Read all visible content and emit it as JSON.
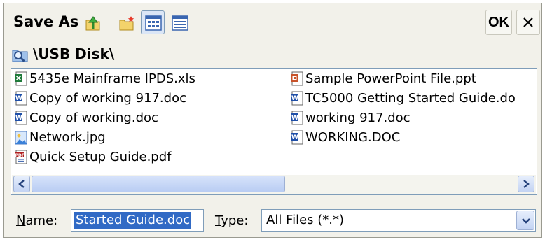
{
  "dialog": {
    "title": "Save As",
    "ok_label": "OK",
    "close_label": "×"
  },
  "toolbar": {
    "buttons": [
      {
        "icon": "up-folder-icon",
        "active": false
      },
      {
        "icon": "new-folder-icon",
        "active": false
      },
      {
        "icon": "list-view-icon",
        "active": true
      },
      {
        "icon": "details-view-icon",
        "active": false
      }
    ]
  },
  "path": {
    "icon": "search-folder-icon",
    "text": "\\USB Disk\\"
  },
  "files": [
    {
      "name": "5435e Mainframe IPDS.xls",
      "icon": "excel-file-icon"
    },
    {
      "name": "Copy of working 917.doc",
      "icon": "word-file-icon"
    },
    {
      "name": "Copy of working.doc",
      "icon": "word-file-icon"
    },
    {
      "name": "Network.jpg",
      "icon": "image-file-icon"
    },
    {
      "name": "Quick Setup Guide.pdf",
      "icon": "pdf-file-icon"
    },
    {
      "name": "Sample PowerPoint File.ppt",
      "icon": "powerpoint-file-icon"
    },
    {
      "name": "TC5000 Getting Started Guide.do",
      "icon": "word-file-icon"
    },
    {
      "name": "working 917.doc",
      "icon": "word-file-icon"
    },
    {
      "name": "WORKING.DOC",
      "icon": "word-file-icon"
    }
  ],
  "bottom": {
    "name_label_first": "N",
    "name_label_rest": "ame:",
    "name_value": "Started Guide.doc",
    "type_label_first": "T",
    "type_label_rest": "ype:",
    "type_value": "All Files (*.*)"
  },
  "colors": {
    "selection": "#316ac5",
    "border": "#7f9db9",
    "dialog_bg": "#f2f1ea"
  }
}
